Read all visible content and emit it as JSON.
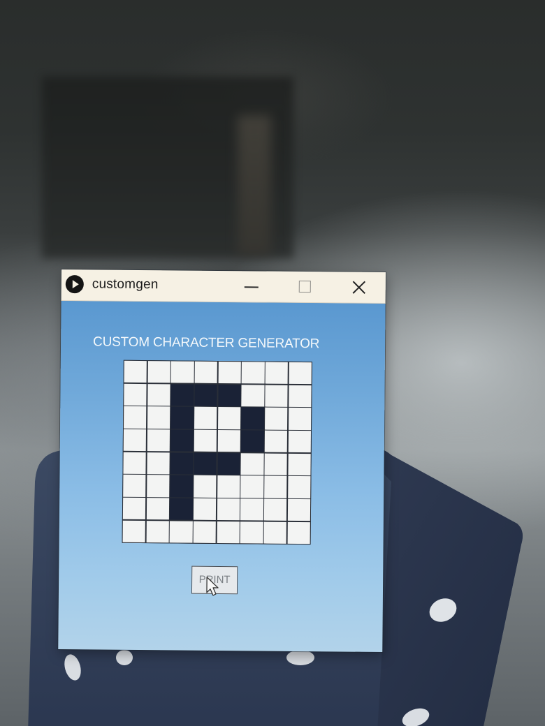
{
  "window": {
    "title": "customgen",
    "controls": [
      "minimize",
      "maximize",
      "close"
    ]
  },
  "app": {
    "heading": "CUSTOM CHARACTER GENERATOR",
    "grid": {
      "rows": 8,
      "cols": 8,
      "pattern": [
        [
          0,
          0,
          0,
          0,
          0,
          0,
          0,
          0
        ],
        [
          0,
          0,
          1,
          1,
          1,
          0,
          0,
          0
        ],
        [
          0,
          0,
          1,
          0,
          0,
          1,
          0,
          0
        ],
        [
          0,
          0,
          1,
          0,
          0,
          1,
          0,
          0
        ],
        [
          0,
          0,
          1,
          1,
          1,
          0,
          0,
          0
        ],
        [
          0,
          0,
          1,
          0,
          0,
          0,
          0,
          0
        ],
        [
          0,
          0,
          1,
          0,
          0,
          0,
          0,
          0
        ],
        [
          0,
          0,
          0,
          0,
          0,
          0,
          0,
          0
        ]
      ]
    },
    "print_label": "PRINT"
  },
  "colors": {
    "cell_on": "#1a2236",
    "cell_off": "#f3f4f3",
    "window_bg": "#6fa8d9",
    "titlebar_bg": "#f6f1e4"
  },
  "icons": {
    "app": "play-circle-icon",
    "minimize": "minimize-icon",
    "maximize": "maximize-icon",
    "close": "close-icon",
    "pointer": "mouse-pointer-icon"
  }
}
